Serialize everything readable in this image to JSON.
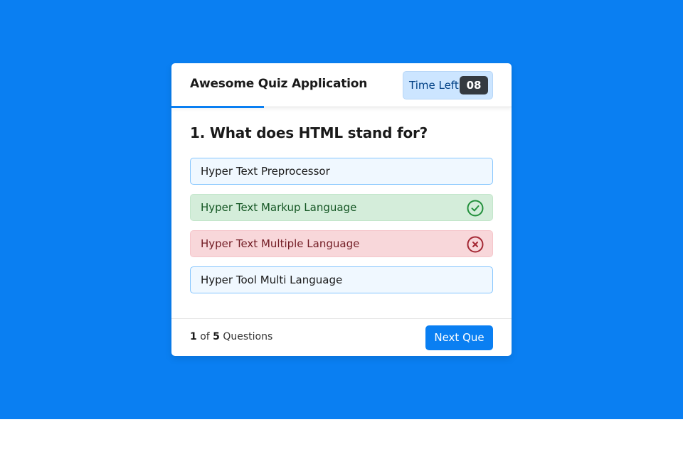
{
  "quiz": {
    "title": "Awesome Quiz Application",
    "timer_label": "Time Left",
    "timer_value": "08"
  },
  "question": {
    "text": "1. What does HTML stand for?",
    "options": [
      {
        "label": "Hyper Text Preprocessor",
        "state": "default"
      },
      {
        "label": "Hyper Text Markup Language",
        "state": "correct"
      },
      {
        "label": "Hyper Text Multiple Language",
        "state": "incorrect"
      },
      {
        "label": "Hyper Tool Multi Language",
        "state": "default"
      }
    ]
  },
  "footer": {
    "current": "1",
    "of": "of",
    "total": "5",
    "questions_label": "Questions",
    "next_label": "Next Que"
  },
  "icons": {
    "correct": "check-circle-icon",
    "incorrect": "x-circle-icon"
  },
  "colors": {
    "background": "#0a7ff2",
    "accent": "#0a7ff2",
    "correct_bg": "#d4edda",
    "incorrect_bg": "#f8d7da",
    "option_bg": "#f0f8ff"
  }
}
